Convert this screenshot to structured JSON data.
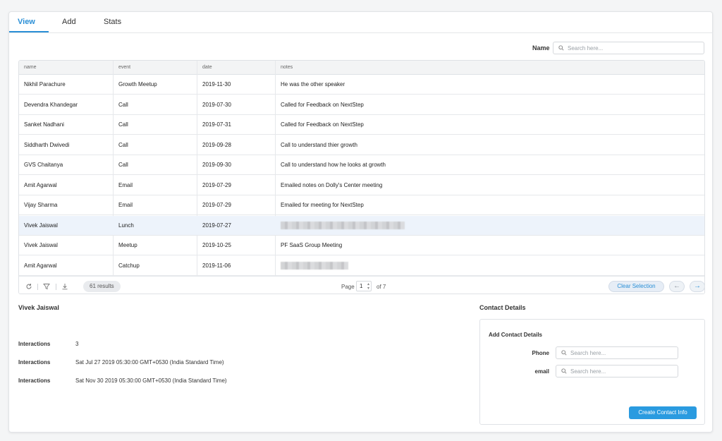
{
  "tabs": [
    {
      "label": "View",
      "active": true
    },
    {
      "label": "Add",
      "active": false
    },
    {
      "label": "Stats",
      "active": false
    }
  ],
  "filter": {
    "label": "Name",
    "placeholder": "Search here..."
  },
  "table": {
    "columns": [
      "name",
      "event",
      "date",
      "notes"
    ],
    "rows": [
      {
        "name": "Nikhil Parachure",
        "event": "Growth Meetup",
        "date": "2019-11-30",
        "notes": "He was the other speaker"
      },
      {
        "name": "Devendra Khandegar",
        "event": "Call",
        "date": "2019-07-30",
        "notes": "Called for Feedback on NextStep"
      },
      {
        "name": "Sanket Nadhani",
        "event": "Call",
        "date": "2019-07-31",
        "notes": "Called for Feedback on NextStep"
      },
      {
        "name": "Siddharth Dwivedi",
        "event": "Call",
        "date": "2019-09-28",
        "notes": "Call to understand thier growth"
      },
      {
        "name": "GVS Chaitanya",
        "event": "Call",
        "date": "2019-09-30",
        "notes": "Call to understand how he looks at growth"
      },
      {
        "name": "Amit Agarwal",
        "event": "Email",
        "date": "2019-07-29",
        "notes": "Emailed notes on Dolly's Center meeting"
      },
      {
        "name": "Vijay Sharma",
        "event": "Email",
        "date": "2019-07-29",
        "notes": "Emailed for meeting for NextStep"
      },
      {
        "name": "Vivek Jaiswal",
        "event": "Lunch",
        "date": "2019-07-27",
        "notes": ""
      },
      {
        "name": "Vivek Jaiswal",
        "event": "Meetup",
        "date": "2019-10-25",
        "notes": "PF SaaS Group Meeting"
      },
      {
        "name": "Amit Agarwal",
        "event": "Catchup",
        "date": "2019-11-06",
        "notes": ""
      }
    ],
    "selected_row": 7,
    "footer": {
      "results": "61 results",
      "page_label": "Page",
      "page_value": "1",
      "of_label": "of 7",
      "clear_selection": "Clear Selection"
    }
  },
  "detail": {
    "name": "Vivek Jaiswal",
    "interactions": [
      {
        "label": "Interactions",
        "value": "3"
      },
      {
        "label": "Interactions",
        "value": "Sat Jul 27 2019 05:30:00 GMT+0530 (India Standard Time)"
      },
      {
        "label": "Interactions",
        "value": "Sat Nov 30 2019 05:30:00 GMT+0530 (India Standard Time)"
      }
    ]
  },
  "contact": {
    "title": "Contact Details",
    "form_title": "Add Contact Details",
    "phone_label": "Phone",
    "phone_placeholder": "Search here...",
    "email_label": "email",
    "email_placeholder": "Search here...",
    "create_button": "Create Contact Info"
  },
  "colors": {
    "accent": "#2a8fd6",
    "button": "#2a9be0",
    "selected_row": "#edf3fb"
  }
}
